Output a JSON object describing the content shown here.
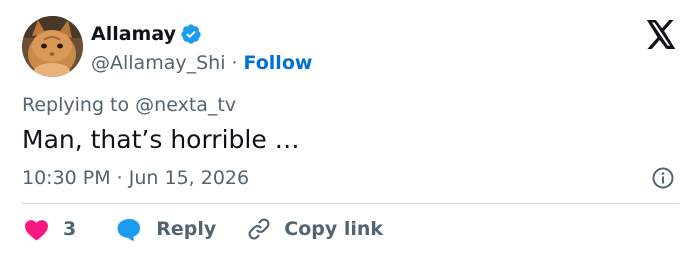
{
  "author": {
    "display_name": "Allamay",
    "handle": "@Allamay_Shi",
    "separator": "·",
    "follow_label": "Follow",
    "verified_icon": "verified-badge-icon",
    "avatar": "avatar-kitten"
  },
  "brand": {
    "logo_icon": "x-logo-icon"
  },
  "reply_context": {
    "prefix": "Replying to",
    "mention": "@nexta_tv"
  },
  "tweet": {
    "text": "Man, that’s horrible …",
    "timestamp": "10:30 PM · Jun 15, 2026"
  },
  "actions": {
    "like_count": "3",
    "reply_label": "Reply",
    "copy_link_label": "Copy link"
  },
  "colors": {
    "text_primary": "#0f1419",
    "text_secondary": "#536471",
    "accent_blue": "#006fd6",
    "verified_blue": "#1d9bf0",
    "like_pink": "#f91880",
    "divider": "#cfd9de"
  }
}
